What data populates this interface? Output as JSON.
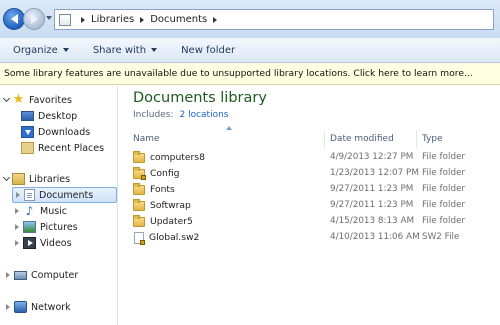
{
  "address": {
    "crumbs": [
      "Libraries",
      "Documents"
    ]
  },
  "toolbar": {
    "organize": "Organize",
    "share_with": "Share with",
    "new_folder": "New folder"
  },
  "infobar": {
    "message": "Some library features are unavailable due to unsupported library locations. Click here to learn more..."
  },
  "nav": {
    "favorites": "Favorites",
    "desktop": "Desktop",
    "downloads": "Downloads",
    "recent_places": "Recent Places",
    "libraries": "Libraries",
    "documents": "Documents",
    "music": "Music",
    "pictures": "Pictures",
    "videos": "Videos",
    "computer": "Computer",
    "network": "Network"
  },
  "content": {
    "title": "Documents library",
    "includes_label": "Includes:",
    "includes_link": "2 locations",
    "columns": {
      "name": "Name",
      "date_modified": "Date modified",
      "type": "Type"
    },
    "files": [
      {
        "name": "computers8",
        "date": "4/9/2013 12:27 PM",
        "type": "File folder",
        "icon": "folder-icon"
      },
      {
        "name": "Config",
        "date": "1/23/2013 12:07 PM",
        "type": "File folder",
        "icon": "folder-lock-icon"
      },
      {
        "name": "Fonts",
        "date": "9/27/2011 1:23 PM",
        "type": "File folder",
        "icon": "folder-icon"
      },
      {
        "name": "Softwrap",
        "date": "9/27/2011 1:23 PM",
        "type": "File folder",
        "icon": "folder-icon"
      },
      {
        "name": "Updater5",
        "date": "4/15/2013 8:13 AM",
        "type": "File folder",
        "icon": "folder-icon"
      },
      {
        "name": "Global.sw2",
        "date": "4/10/2013 11:06 AM",
        "type": "SW2 File",
        "icon": "file-lock-icon"
      }
    ]
  },
  "colors": {
    "title_green": "#1e5b1e",
    "link_blue": "#1e64c8",
    "infobar_bg": "#ffffe1"
  }
}
